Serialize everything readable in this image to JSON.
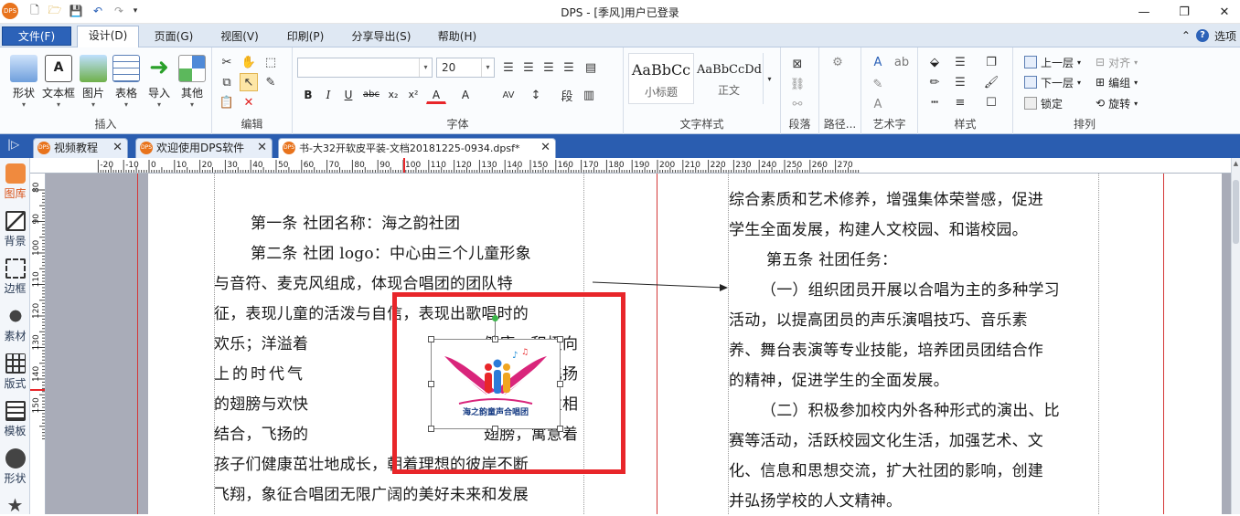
{
  "titlebar": {
    "title": "DPS - [季风]用户已登录",
    "minimize": "—",
    "restore": "❐",
    "close": "✕"
  },
  "menus": {
    "file": "文件(F)",
    "items": [
      "设计(D)",
      "页面(G)",
      "视图(V)",
      "印刷(P)",
      "分享导出(S)",
      "帮助(H)"
    ],
    "options": "选项",
    "collapse": "⌃",
    "help": "?"
  },
  "ribbon": {
    "insert": {
      "label": "插入",
      "buttons": [
        "形状",
        "文本框",
        "图片",
        "表格",
        "导入",
        "其他"
      ]
    },
    "edit": {
      "label": "编辑"
    },
    "font": {
      "label": "字体",
      "font_name": "",
      "font_size": "20",
      "bold": "B",
      "italic": "I",
      "underline": "U",
      "strike": "abc",
      "sub": "x₂",
      "sup": "x²",
      "color": "A",
      "size": "A"
    },
    "text_style": {
      "label": "文字样式",
      "styles": [
        {
          "sample": "AaBbCc",
          "name": "小标题"
        },
        {
          "sample": "AaBbCcDd",
          "name": "正文"
        }
      ]
    },
    "paragraph": {
      "label": "段落"
    },
    "path": {
      "label": "路径..."
    },
    "wordart": {
      "label": "艺术字"
    },
    "style": {
      "label": "样式"
    },
    "arrange": {
      "label": "排列",
      "up": "上一层",
      "down": "下一层",
      "align": "对齐",
      "group": "编组",
      "lock": "锁定",
      "rotate": "旋转"
    }
  },
  "tabs": [
    {
      "label": "视频教程",
      "active": false
    },
    {
      "label": "欢迎使用DPS软件",
      "active": false
    },
    {
      "label": "书-大32开软皮平装-文档20181225-0934.dpsf*",
      "active": true
    }
  ],
  "sidebar": [
    "图库",
    "背景",
    "边框",
    "素材",
    "版式",
    "模板",
    "形状"
  ],
  "rulers": {
    "h": [
      "-20",
      "-10",
      "0",
      "10",
      "20",
      "30",
      "40",
      "50",
      "60",
      "70",
      "80",
      "90",
      "100",
      "110",
      "120",
      "130",
      "140",
      "150",
      "160",
      "170",
      "180",
      "190",
      "200",
      "210",
      "220",
      "230",
      "240",
      "250",
      "260",
      "270"
    ],
    "v": [
      "80",
      "90",
      "100",
      "110",
      "120",
      "130",
      "140",
      "150"
    ]
  },
  "doc": {
    "left": [
      "第一条 社团名称：海之韵社团",
      "第二条 社团 logo：中心由三个儿童形象",
      "与音符、麦克风组成，体现合唱团的团队特",
      "征，表现儿童的活泼与自信，表现出歌唱时的",
      "欢乐；洋溢着",
      "上的时代气",
      "的翅膀与欢快",
      "结合，飞扬的",
      "孩子们健康茁壮地成长，朝着理想的彼岸不断",
      "飞翔，象征合唱团无限广阔的美好未来和发展"
    ],
    "left_right": [
      "健康、积极向",
      "息；外围飞扬",
      "歌唱的儿童相",
      "翅膀，寓意着"
    ],
    "right": [
      "综合素质和艺术修养，增强集体荣誉感，促进",
      "学生全面发展，构建人文校园、和谐校园。",
      "第五条 社团任务：",
      "（一）组织团员开展以合唱为主的多种学习",
      "活动，以提高团员的声乐演唱技巧、音乐素",
      "养、舞台表演等专业技能，培养团员团结合作",
      "的精神，促进学生的全面发展。",
      "（二）积极参加校内外各种形式的演出、比",
      "赛等活动，活跃校园文化生活，加强艺术、文",
      "化、信息和思想交流，扩大社团的影响，创建",
      "并弘扬学校的人文精神。"
    ],
    "logo_caption": "海之韵童声合唱团"
  },
  "colors": {
    "accent": "#2c62b8",
    "highlight": "#e8262a",
    "workspace": "#a9acb8"
  }
}
